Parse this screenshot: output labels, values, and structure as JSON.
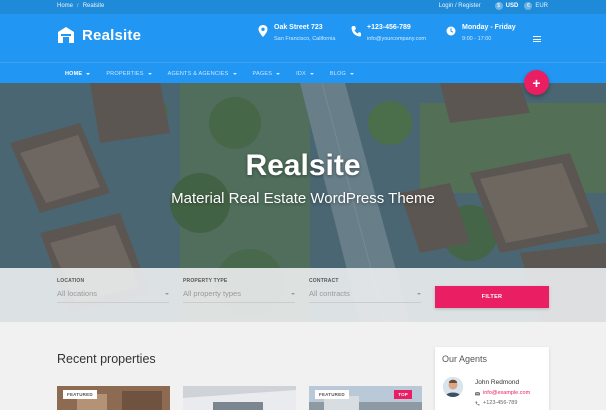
{
  "topbar": {
    "breadcrumbs": [
      "Home",
      "Realsite"
    ],
    "login_register": "Login / Register",
    "currencies": [
      {
        "symbol": "$",
        "code": "USD"
      },
      {
        "symbol": "€",
        "code": "EUR"
      }
    ]
  },
  "header": {
    "logo_text": "Realsite",
    "address": {
      "line1": "Oak Street 723",
      "line2": "San Francisco, California",
      "icon": "location-pin-icon"
    },
    "contact": {
      "line1": "+123-456-789",
      "line2": "info@yourcompany.com",
      "icon": "phone-icon"
    },
    "hours": {
      "line1": "Monday - Friday",
      "line2": "9:00 - 17:00",
      "icon": "clock-icon"
    },
    "menu_icon": "hamburger-menu-icon"
  },
  "nav": {
    "items": [
      "HOME",
      "PROPERTIES",
      "AGENTS & AGENCIES",
      "PAGES",
      "IDX",
      "BLOG"
    ],
    "active": "HOME"
  },
  "fab": {
    "label": "+",
    "icon": "plus-icon"
  },
  "hero": {
    "title": "Realsite",
    "subtitle": "Material Real Estate WordPress Theme"
  },
  "search": {
    "location": {
      "label": "LOCATION",
      "value": "All locations"
    },
    "property_type": {
      "label": "PROPERTY TYPE",
      "value": "All property types"
    },
    "contract": {
      "label": "CONTRACT",
      "value": "All contracts"
    },
    "filter_label": "FILTER"
  },
  "recent": {
    "title": "Recent properties",
    "cards": [
      {
        "badge": "FEATURED"
      },
      {
        "badge": ""
      },
      {
        "badge": "FEATURED",
        "badge_right": "TOP"
      }
    ]
  },
  "agents": {
    "title": "Our Agents",
    "list": [
      {
        "name": "John Redmond",
        "email": "info@example.com",
        "phone": "+123-456-789"
      }
    ]
  },
  "colors": {
    "primary": "#2196f3",
    "topbar": "#1e8ad8",
    "accent": "#e91e63"
  }
}
